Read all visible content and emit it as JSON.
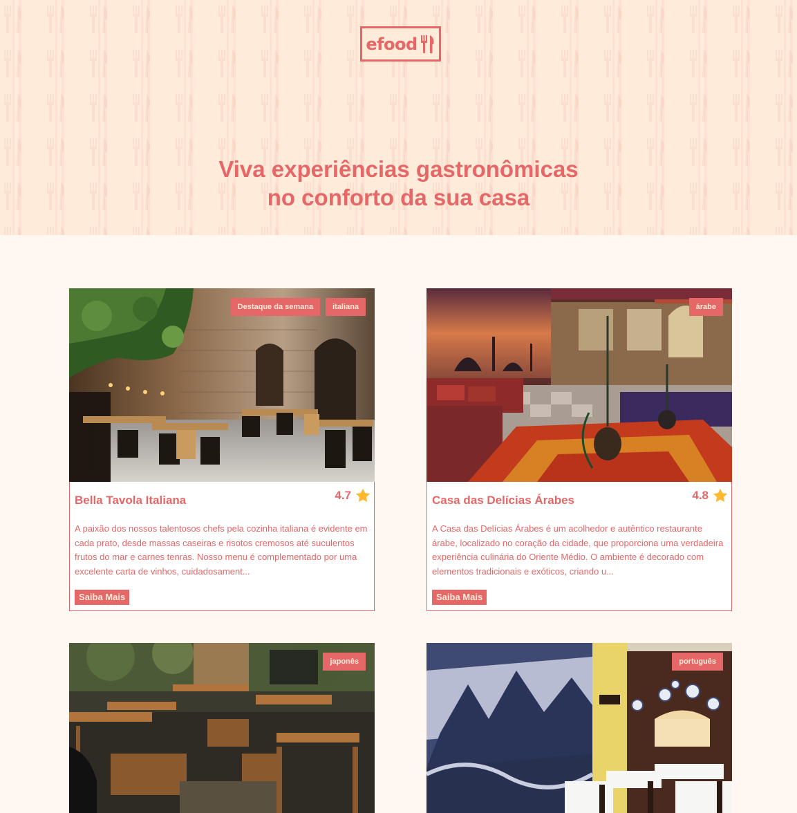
{
  "header": {
    "logo_text": "efood",
    "logo_icon": "fork-knife-icon",
    "title_line1": "Viva experiências gastronômicas",
    "title_line2": "no conforto da sua casa"
  },
  "colors": {
    "primary": "#E66767",
    "hero_bg": "#FFEBD9",
    "page_bg": "#FFF8F2",
    "star": "#FFB930"
  },
  "restaurants": [
    {
      "name": "Bella Tavola Italiana",
      "rating": "4.7",
      "tags": [
        "Destaque da semana",
        "italiana"
      ],
      "description": "A paixão dos nossos talentosos chefs pela cozinha italiana é evidente em cada prato, desde massas caseiras e risotos cremosos até suculentos frutos do mar e carnes tenras. Nosso menu é complementado por uma excelente carta de vinhos, cuidadosament...",
      "button": "Saiba Mais"
    },
    {
      "name": "Casa das Delícias Árabes",
      "rating": "4.8",
      "tags": [
        "árabe"
      ],
      "description": "A Casa das Delícias Árabes é um acolhedor e autêntico restaurante árabe, localizado no coração da cidade, que proporciona uma verdadeira experiência culinária do Oriente Médio. O ambiente é decorado com elementos tradicionais e exóticos, criando u...",
      "button": "Saiba Mais"
    },
    {
      "tags": [
        "japonês"
      ]
    },
    {
      "tags": [
        "português"
      ]
    }
  ]
}
